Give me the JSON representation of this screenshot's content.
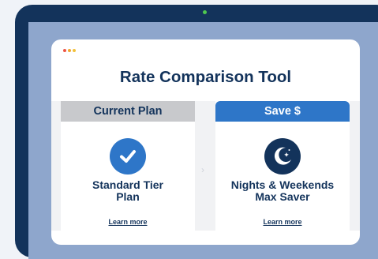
{
  "app": {
    "title": "Rate Comparison Tool"
  },
  "plans": [
    {
      "header": "Current Plan",
      "name_line1": "Standard Tier",
      "name_line2": "Plan",
      "link": "Learn more",
      "icon": "checkmark-icon"
    },
    {
      "header": "Save $",
      "name_line1": "Nights & Weekends",
      "name_line2": "Max Saver",
      "link": "Learn more",
      "icon": "moon-stars-icon"
    }
  ],
  "divider_glyph": "›",
  "colors": {
    "navy": "#13335b",
    "blue": "#2e76c8",
    "gray_header": "#c8c9cc",
    "camera_green": "#4fc94f"
  }
}
